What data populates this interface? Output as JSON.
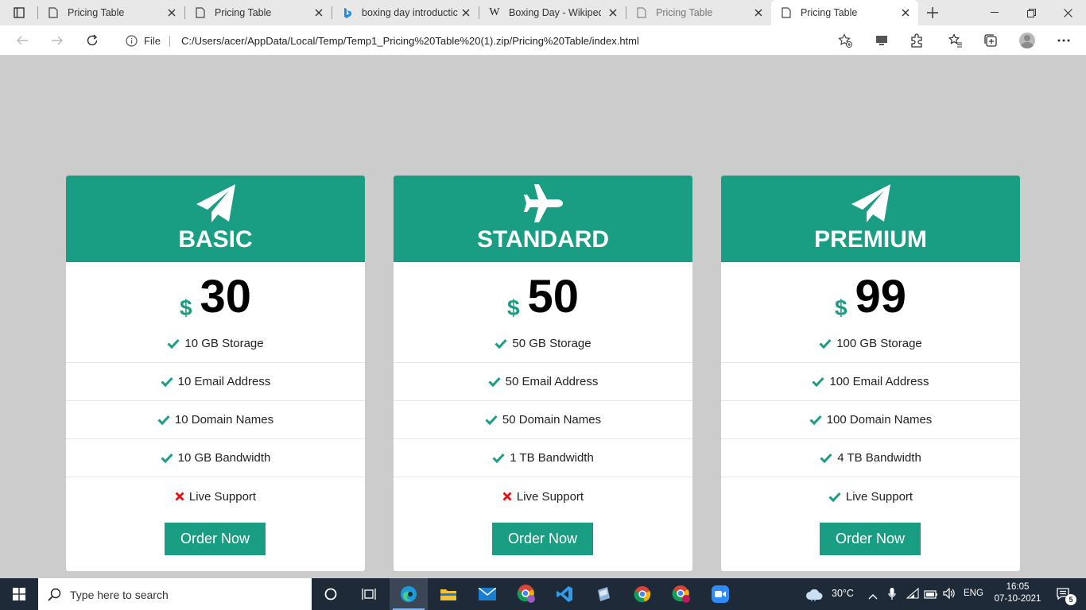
{
  "browser": {
    "tabs": [
      {
        "title": "Pricing Table",
        "icon": "page-icon",
        "active": false
      },
      {
        "title": "Pricing Table",
        "icon": "page-icon",
        "active": false
      },
      {
        "title": "boxing day introductic",
        "icon": "bing-icon",
        "active": false
      },
      {
        "title": "Boxing Day - Wikiped",
        "icon": "wikipedia-icon",
        "active": false
      },
      {
        "title": "Pricing Table",
        "icon": "page-icon",
        "active": false
      },
      {
        "title": "Pricing Table",
        "icon": "page-icon",
        "active": true
      }
    ],
    "address": {
      "scheme_label": "File",
      "url": "C:/Users/acer/AppData/Local/Temp/Temp1_Pricing%20Table%20(1).zip/Pricing%20Table/index.html"
    }
  },
  "page": {
    "accent_color": "#1a9e83",
    "plans": [
      {
        "name": "BASIC",
        "icon": "paper-plane-icon",
        "currency": "$",
        "price": "30",
        "features": [
          {
            "text": "10 GB Storage",
            "included": true
          },
          {
            "text": "10 Email Address",
            "included": true
          },
          {
            "text": "10 Domain Names",
            "included": true
          },
          {
            "text": "10 GB Bandwidth",
            "included": true
          },
          {
            "text": "Live Support",
            "included": false
          }
        ],
        "button": "Order Now"
      },
      {
        "name": "STANDARD",
        "icon": "airplane-icon",
        "currency": "$",
        "price": "50",
        "features": [
          {
            "text": "50 GB Storage",
            "included": true
          },
          {
            "text": "50 Email Address",
            "included": true
          },
          {
            "text": "50 Domain Names",
            "included": true
          },
          {
            "text": "1 TB Bandwidth",
            "included": true
          },
          {
            "text": "Live Support",
            "included": false
          }
        ],
        "button": "Order Now"
      },
      {
        "name": "PREMIUM",
        "icon": "paper-plane-icon",
        "currency": "$",
        "price": "99",
        "features": [
          {
            "text": "100 GB Storage",
            "included": true
          },
          {
            "text": "100 Email Address",
            "included": true
          },
          {
            "text": "100 Domain Names",
            "included": true
          },
          {
            "text": "4 TB Bandwidth",
            "included": true
          },
          {
            "text": "Live Support",
            "included": true
          }
        ],
        "button": "Order Now"
      }
    ]
  },
  "taskbar": {
    "search_placeholder": "Type here to search",
    "weather": "30°C",
    "language": "ENG",
    "time": "16:05",
    "date": "07-10-2021",
    "notification_count": "5"
  }
}
